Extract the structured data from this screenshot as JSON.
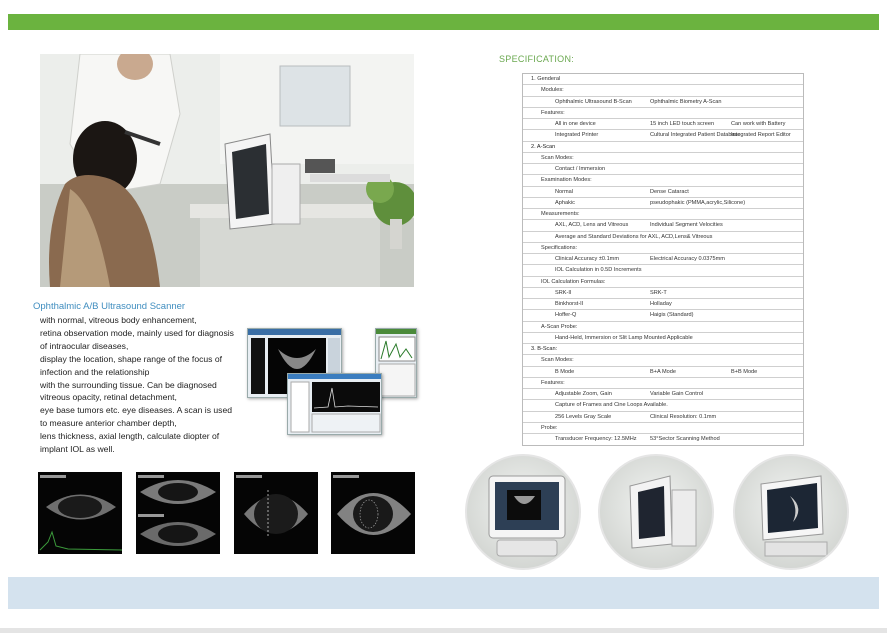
{
  "product": {
    "title": "Ophthalmic A/B Ultrasound Scanner",
    "description_lines": [
      "with normal, vitreous body enhancement,",
      "retina observation mode, mainly used for diagnosis",
      "of intraocular diseases,",
      "display the location, shape range of the focus of",
      "infection and the relationship",
      "with the surrounding tissue. Can be diagnosed",
      "vitreous opacity, retinal detachment,",
      "eye base tumors etc. eye diseases. A scan is used",
      "to measure anterior chamber depth,",
      "lens thickness, axial length, calculate diopter of",
      "implant IOL as well."
    ]
  },
  "spec": {
    "heading": "SPECIFICATION:",
    "rows": [
      [
        "1. Genderal"
      ],
      [
        "Modules:"
      ],
      [
        "Ophthalmic Ultrasound B-Scan",
        "Ophthalmic Biometry A-Scan"
      ],
      [
        "Features:"
      ],
      [
        "All in one device",
        "15 inch LED touch screen",
        "Can work with Battery"
      ],
      [
        "Integrated Printer",
        "Cultural Integrated Patient Database",
        "Integrated Report Editor"
      ],
      [
        "2.  A-Scan"
      ],
      [
        "Scan Modes:"
      ],
      [
        "Contact / Immersion"
      ],
      [
        "Examination Modes:"
      ],
      [
        "Normal",
        "Dense Cataract"
      ],
      [
        "Aphakic",
        "pseudophakic (PMMA,acrylic,Silicone)"
      ],
      [
        "Measurements:"
      ],
      [
        "AXL, ACD, Lens and Vitreous",
        "Individual Segment Velocities"
      ],
      [
        "Average and Standard Deviations for AXL, ACD,Lens& Vitreous"
      ],
      [
        "Specifications:"
      ],
      [
        "Clinical Accuracy  ±0.1mm",
        "Electrical Accuracy 0.0375mm"
      ],
      [
        "IOL Calculation in 0.5D Increments"
      ],
      [
        "IOL Calculation Formulas:"
      ],
      [
        "SRK-II",
        "SRK-T"
      ],
      [
        "Binkhorst-II",
        "Holladay"
      ],
      [
        "Hoffer-Q",
        "Haigis (Standard)"
      ],
      [
        "A-Scan Probe:"
      ],
      [
        "Hand-Held, Immersion or Slit Lamp Mounted Applicable"
      ],
      [
        "3. B-Scan:"
      ],
      [
        "Scan Modes:"
      ],
      [
        "B Mode",
        "B+A Mode",
        "B+B Mode"
      ],
      [
        "Features:"
      ],
      [
        "Adjustable Zoom, Gain",
        "Variable Gain Control"
      ],
      [
        "Capture of Frames and Cine Loops Available."
      ],
      [
        "256 Levels Gray Scale",
        "Clinical Resolution: 0.1mm"
      ],
      [
        "Probe:"
      ],
      [
        "Transducer Frequency: 12.5MHz",
        "53°Sector Scanning Method"
      ]
    ],
    "indents": [
      1,
      2,
      3,
      2,
      3,
      3,
      1,
      2,
      3,
      2,
      3,
      3,
      2,
      3,
      3,
      2,
      3,
      3,
      2,
      3,
      3,
      3,
      2,
      3,
      1,
      2,
      3,
      2,
      3,
      3,
      3,
      2,
      3
    ]
  },
  "colors": {
    "brand_green": "#6bb33f",
    "title_blue": "#3f8dbf",
    "footer_blue": "#d4e2ee"
  }
}
